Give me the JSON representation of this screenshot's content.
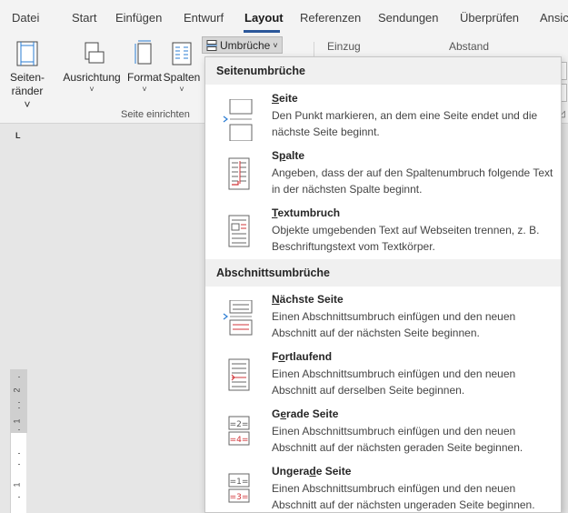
{
  "ribbon_tabs": [
    {
      "label": "Datei",
      "active": false
    },
    {
      "label": "Start",
      "active": false
    },
    {
      "label": "Einfügen",
      "active": false
    },
    {
      "label": "Entwurf",
      "active": false
    },
    {
      "label": "Layout",
      "active": true
    },
    {
      "label": "Referenzen",
      "active": false
    },
    {
      "label": "Sendungen",
      "active": false
    },
    {
      "label": "Überprüfen",
      "active": false
    },
    {
      "label": "Ansic",
      "active": false
    }
  ],
  "ribbon": {
    "buttons": [
      {
        "line1": "Seiten-",
        "line2": "ränder ˅",
        "icon": "margins-icon"
      },
      {
        "line1": "Ausrichtung",
        "line2": "˅",
        "icon": "orientation-icon"
      },
      {
        "line1": "Format",
        "line2": "˅",
        "icon": "page-size-icon"
      },
      {
        "line1": "Spalten",
        "line2": "˅",
        "icon": "columns-icon"
      }
    ],
    "group_label": "Seite einrichten",
    "umbrueche_label": "Umbrüche",
    "umbrueche_chevron": "˅",
    "einzug_label": "Einzug",
    "abstand_label": "Abstand"
  },
  "menu": {
    "section1_title": "Seitenumbrüche",
    "section2_title": "Abschnittsumbrüche",
    "items": [
      {
        "title_u": "S",
        "title_rest": "eite",
        "desc": "Den Punkt markieren, an dem eine Seite endet und die nächste Seite beginnt.",
        "icon": "page-break-icon"
      },
      {
        "title_pre": "S",
        "title_u": "p",
        "title_rest": "alte",
        "desc": "Angeben, dass der auf den Spaltenumbruch folgende Text in der nächsten Spalte beginnt.",
        "icon": "column-break-icon"
      },
      {
        "title_u": "T",
        "title_rest": "extumbruch",
        "desc": "Objekte umgebenden Text auf Webseiten trennen, z. B. Beschriftungstext vom Textkörper.",
        "icon": "text-wrapping-icon"
      },
      {
        "title_u": "N",
        "title_rest": "ächste Seite",
        "desc": "Einen Abschnittsumbruch einfügen und den neuen Abschnitt auf der nächsten Seite beginnen.",
        "icon": "next-page-icon"
      },
      {
        "title_pre": "F",
        "title_u": "o",
        "title_rest": "rtlaufend",
        "desc": "Einen Abschnittsumbruch einfügen und den neuen Abschnitt auf derselben Seite beginnen.",
        "icon": "continuous-icon"
      },
      {
        "title_pre": "G",
        "title_u": "e",
        "title_rest": "rade Seite",
        "desc": "Einen Abschnittsumbruch einfügen und den neuen Abschnitt auf der nächsten geraden Seite beginnen.",
        "icon": "even-page-icon"
      },
      {
        "title_pre": "Ungera",
        "title_u": "d",
        "title_rest": "e Seite",
        "desc": "Einen Abschnittsumbruch einfügen und den neuen Abschnitt auf der nächsten ungeraden Seite beginnen.",
        "icon": "odd-page-icon"
      }
    ]
  },
  "ruler": {
    "tab_marker": "L",
    "numbers": [
      "2",
      "1",
      "1"
    ]
  },
  "colors": {
    "accent": "#2b579a",
    "break_red": "#d13438"
  }
}
